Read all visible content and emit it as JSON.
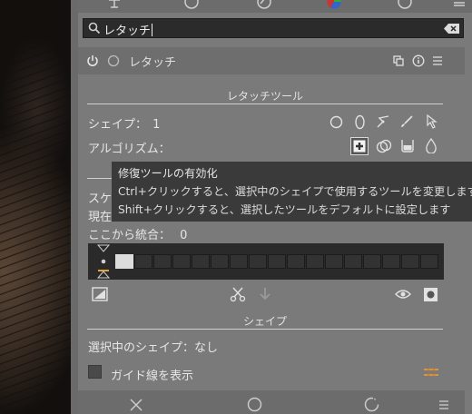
{
  "search": {
    "value": "レタッチ"
  },
  "module": {
    "title": "レタッチ"
  },
  "retouch_tools": {
    "section_title": "レタッチツール",
    "shapes_label": "シェイプ：",
    "shapes_count": "1",
    "algorithm_label": "アルゴリズム："
  },
  "scale": {
    "label_fragment_1": "スケ",
    "label_fragment_2": "現在",
    "merge_label": "ここから統合：",
    "merge_value": "0"
  },
  "tooltip": {
    "title": "修復ツールの有効化",
    "line1": "Ctrl+クリックすると、選択中のシェイプで使用するツールを変更します",
    "line2": "Shift+クリックすると、選択したツールをデフォルトに設定します"
  },
  "shapes_section": {
    "section_title": "シェイプ",
    "selected_shape": "選択中のシェイプ：なし",
    "show_guides": "ガイド線を表示"
  },
  "icons": {
    "search": "search-icon",
    "clear": "clear-icon",
    "power": "power-icon",
    "circle_shape": "circle-shape-icon",
    "ellipse_shape": "ellipse-shape-icon",
    "path_shape": "path-shape-icon",
    "brush_shape": "brush-shape-icon",
    "show_shapes": "show-shapes-icon",
    "heal": "heal-icon",
    "clone": "clone-icon",
    "fill": "fill-icon",
    "blur": "blur-icon"
  },
  "colors": {
    "accent_orange": "#e8a23a",
    "panel_bg": "#7a7a7a",
    "search_bg": "#2b2b2b",
    "tooltip_bg": "#3a3a3a"
  }
}
